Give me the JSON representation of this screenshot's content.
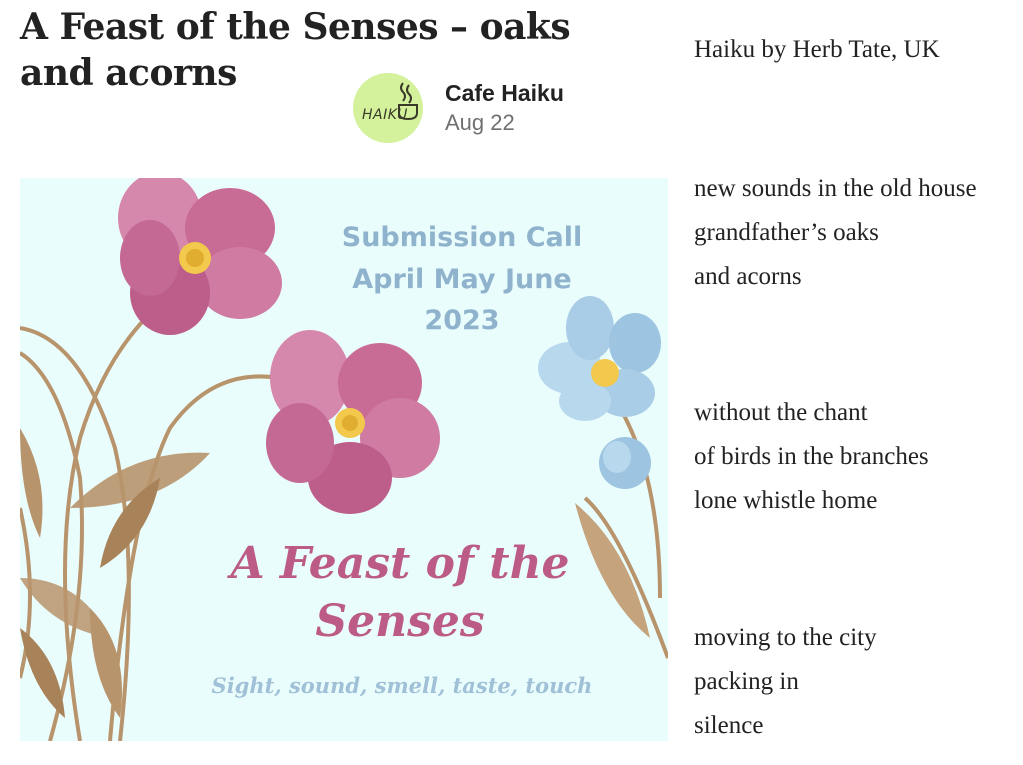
{
  "post": {
    "title_line1": "A Feast of the Senses – oaks",
    "title_line2": "and acorns",
    "author": "Cafe Haiku",
    "date": "Aug 22",
    "avatar_text": "HAIKU"
  },
  "banner": {
    "call_line1": "Submission Call",
    "call_line2": "April May June",
    "call_line3": "2023",
    "feast_line1": "A Feast of the",
    "feast_line2": "Senses",
    "tagline": "Sight, sound, smell, taste, touch"
  },
  "byline": "Haiku by Herb Tate, UK",
  "haiku": [
    [
      "new sounds in the old house",
      "grandfather’s oaks",
      "and acorns"
    ],
    [
      "without the chant",
      "of birds in the branches",
      "lone whistle home"
    ],
    [
      "moving to the city",
      "packing in",
      "silence"
    ]
  ],
  "colors": {
    "avatar_bg": "#d4f29b",
    "banner_bg": "#eafdfd",
    "pink_accent": "#bb5b86",
    "blue_accent": "#8fb3cc",
    "flower_pink": "#c86b95",
    "flower_blue": "#a9cde6",
    "stem_brown": "#b8946c"
  }
}
